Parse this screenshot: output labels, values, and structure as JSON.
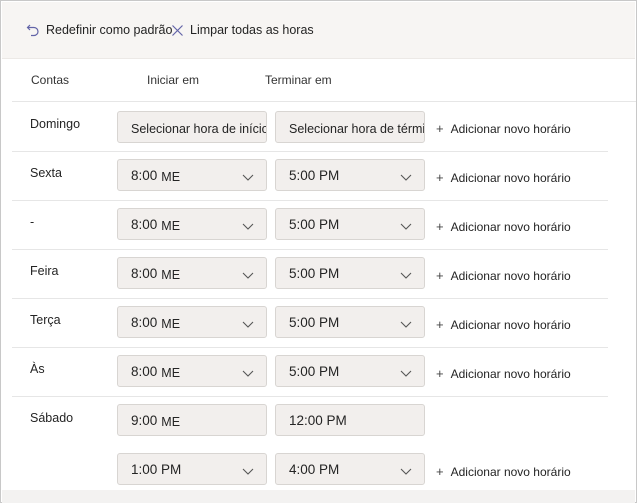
{
  "toolbar": {
    "reset_label": "Redefinir como padrão",
    "clear_label": "Limpar todas as horas"
  },
  "headers": {
    "col1": "Contas",
    "col2": "Iniciar em",
    "col3": "Terminar em"
  },
  "add_label": "Adicionar novo horário",
  "rows": [
    {
      "day": "Domingo",
      "start": "Selecionar hora de início",
      "end": "Selecionar hora de término"
    },
    {
      "day": "Sexta",
      "start": "8:00",
      "start_suffix": "ME",
      "end": "5:00 PM"
    },
    {
      "day": "-",
      "start": "8:00",
      "start_suffix": "ME",
      "end": "5:00 PM"
    },
    {
      "day": "Feira",
      "start": "8:00",
      "start_suffix": "ME",
      "end": "5:00 PM"
    },
    {
      "day": "Terça",
      "start": "8:00",
      "start_suffix": "ME",
      "end": "5:00 PM"
    },
    {
      "day": "Às",
      "start": "8:00",
      "start_suffix": "ME",
      "end": "5:00 PM"
    },
    {
      "day": "Sábado",
      "start": "9:00",
      "start_suffix": "ME",
      "end": "12:00 PM"
    },
    {
      "day": "",
      "start": "1:00 PM",
      "end": "4:00 PM"
    }
  ]
}
